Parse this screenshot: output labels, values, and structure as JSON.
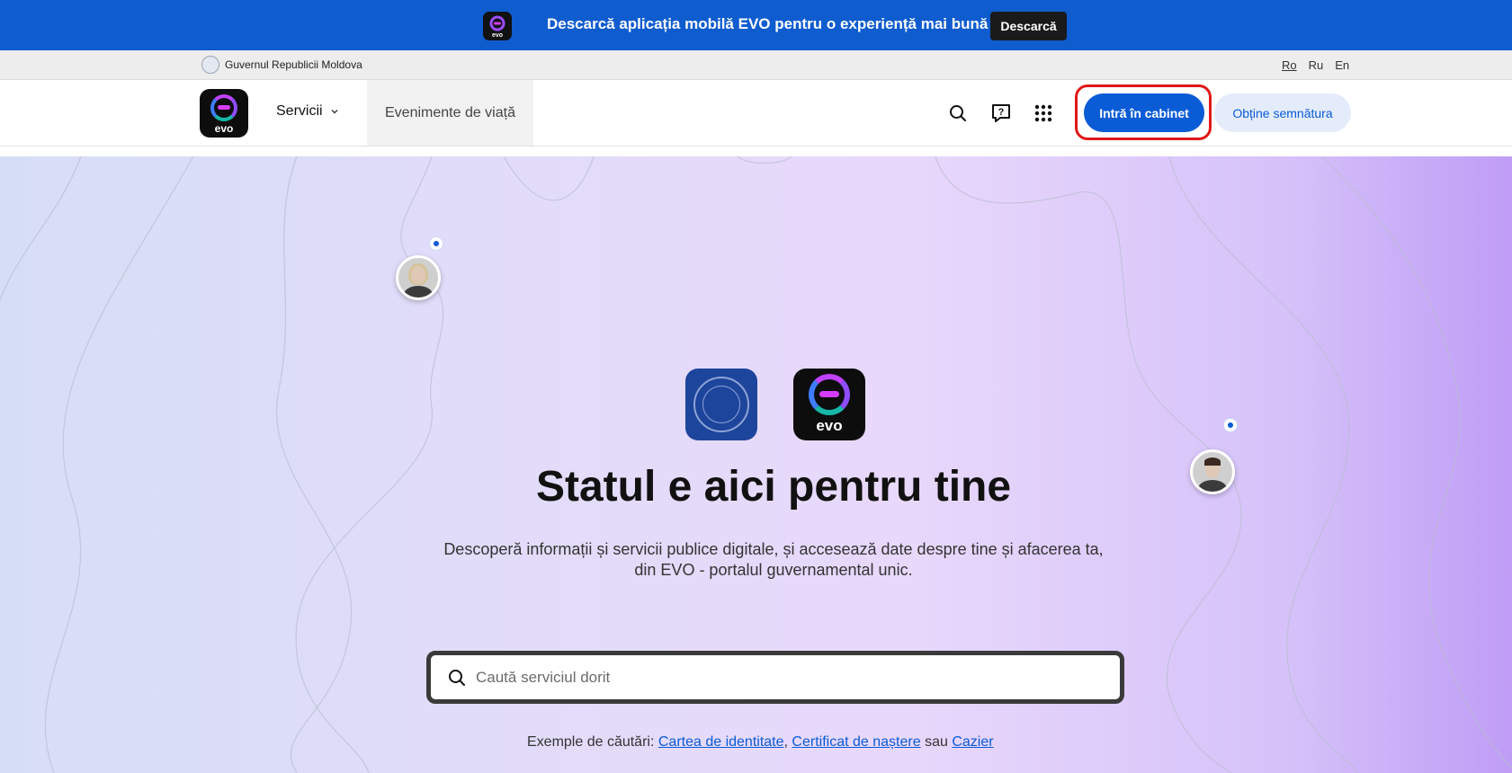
{
  "promo": {
    "text": "Descarcă aplicația mobilă EVO pentru o experiență mai bună",
    "button": "Descarcă",
    "app_word": "evo"
  },
  "gov": {
    "name": "Guvernul Republicii Moldova",
    "languages": [
      "Ro",
      "Ru",
      "En"
    ],
    "active_language": "Ro"
  },
  "header": {
    "logo_word": "evo",
    "nav_servicii": "Servicii",
    "nav_evenimente": "Evenimente de viață",
    "icons": [
      "search-icon",
      "help-chat-icon",
      "apps-grid-icon"
    ],
    "btn_cabinet": "Intră în cabinet",
    "btn_semnatura": "Obține semnătura"
  },
  "hero": {
    "evo_word": "evo",
    "title": "Statul e aici pentru tine",
    "subtitle": "Descoperă informații și servicii publice digitale, și accesează date despre tine și afacerea ta, din EVO - portalul guvernamental unic.",
    "search_placeholder": "Caută serviciul dorit",
    "examples_prefix": "Exemple de căutări:",
    "examples": [
      "Cartea de identitate",
      "Certificat de naștere",
      "Cazier"
    ],
    "examples_sep": ",",
    "examples_or": "sau"
  },
  "colors": {
    "primary": "#0a5bd6",
    "promo_bg": "#0f5ccf",
    "highlight": "#e11818"
  }
}
